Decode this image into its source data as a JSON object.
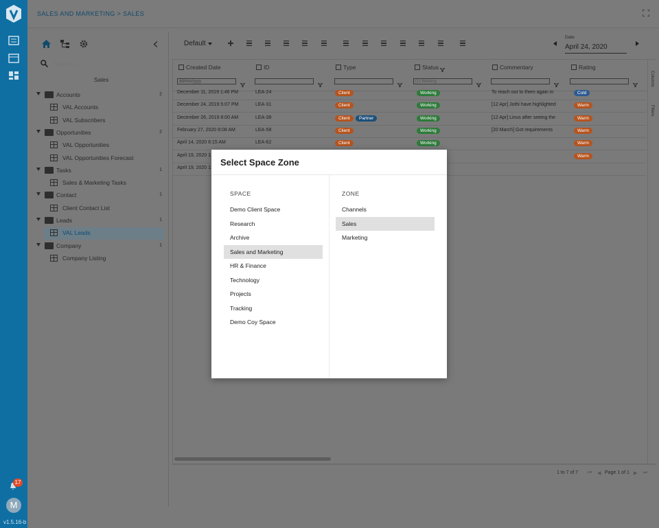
{
  "app": {
    "breadcrumb": "SALES AND MARKETING > SALES",
    "notification_count": "17",
    "avatar_initial": "M",
    "version": "v1.5.16-b"
  },
  "sidebar": {
    "search_placeholder": "Search...",
    "title": "Sales",
    "tree": [
      {
        "type": "folder",
        "label": "Accounts",
        "count": "2"
      },
      {
        "type": "table",
        "label": "VAL Accounts"
      },
      {
        "type": "table",
        "label": "VAL Subscribers"
      },
      {
        "type": "folder",
        "label": "Opportunities",
        "count": "2"
      },
      {
        "type": "table",
        "label": "VAL Opportunities"
      },
      {
        "type": "table",
        "label": "VAL Opportunities Forecast"
      },
      {
        "type": "folder",
        "label": "Tasks",
        "count": "1"
      },
      {
        "type": "table",
        "label": "Sales & Marketing Tasks"
      },
      {
        "type": "folder",
        "label": "Contact",
        "count": "1"
      },
      {
        "type": "table",
        "label": "Client Contact List"
      },
      {
        "type": "folder",
        "label": "Leads",
        "count": "1"
      },
      {
        "type": "table",
        "label": "VAL Leads",
        "selected": true
      },
      {
        "type": "folder",
        "label": "Company",
        "count": "1"
      },
      {
        "type": "table",
        "label": "Company Listing"
      }
    ]
  },
  "toolbar": {
    "view_label": "Default",
    "date_label": "Date",
    "date_value": "April 24, 2020"
  },
  "grid": {
    "columns": [
      "Created Date",
      "ID",
      "Type",
      "Status",
      "Commentary",
      "Rating"
    ],
    "filters": {
      "date_placeholder": "dd/mm/yyyy",
      "status_value": "(1) Working"
    },
    "rows": [
      {
        "date": "December 11, 2019 1:46 PM",
        "id": "LEA-24",
        "type": [
          "Client"
        ],
        "status": "Working",
        "comment": "To reach out to them again in",
        "rating": "Cold"
      },
      {
        "date": "December 24, 2019 5:07 PM",
        "id": "LEA-31",
        "type": [
          "Client"
        ],
        "status": "Working",
        "comment": "[12 Apr] Jothi have highlighted",
        "rating": "Warm"
      },
      {
        "date": "December 26, 2019 8:00 AM",
        "id": "LEA-38",
        "type": [
          "Client",
          "Partner"
        ],
        "status": "Working",
        "comment": "[12 Apr] Linus after seeing the",
        "rating": "Warm"
      },
      {
        "date": "February 27, 2020 8:08 AM",
        "id": "LEA-58",
        "type": [
          "Client"
        ],
        "status": "Working",
        "comment": "[20 March] Got requirements",
        "rating": "Warm"
      },
      {
        "date": "April 14, 2020 8:15 AM",
        "id": "LEA-62",
        "type": [
          "Client"
        ],
        "status": "Working",
        "comment": "",
        "rating": "Warm"
      },
      {
        "date": "April 19, 2020 1:",
        "id": "",
        "type": [],
        "status": "",
        "comment": "",
        "rating": "Warm"
      },
      {
        "date": "April 19, 2020 1:",
        "id": "",
        "type": [],
        "status": "",
        "comment": "",
        "rating": ""
      }
    ],
    "side_tabs": [
      "Columns",
      "Filters"
    ],
    "pagination": {
      "range": "1 to 7 of 7",
      "page_label": "Page",
      "page": "1",
      "of_label": "of",
      "total": "1"
    }
  },
  "modal": {
    "title": "Select Space Zone",
    "space_header": "SPACE",
    "zone_header": "ZONE",
    "spaces": [
      "Demo Client Space",
      "Research",
      "Archive",
      "Sales and Marketing",
      "HR & Finance",
      "Technology",
      "Projects",
      "Tracking",
      "Demo Coy Space"
    ],
    "selected_space": "Sales and Marketing",
    "zones": [
      "Channels",
      "Sales",
      "Marketing"
    ],
    "selected_zone": "Sales"
  },
  "colors": {
    "rail": "#0f6fa3",
    "accent": "#114a6b",
    "client": "#b5541f",
    "working": "#2e7a3a",
    "cold": "#2e5a90"
  }
}
